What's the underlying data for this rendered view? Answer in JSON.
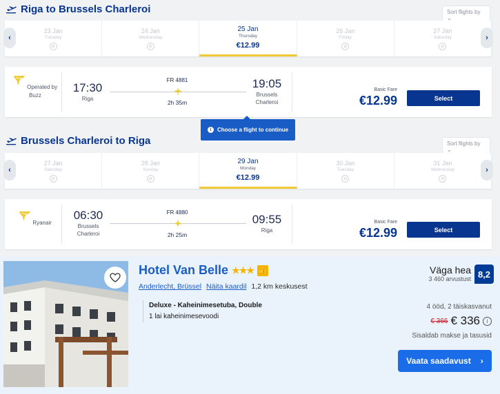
{
  "outbound": {
    "title": "Riga to Brussels Charleroi",
    "sort_label": "Sort flights by",
    "dates": [
      {
        "date": "23 Jan",
        "weekday": "Tuesday",
        "price": ""
      },
      {
        "date": "24 Jan",
        "weekday": "Wednesday",
        "price": ""
      },
      {
        "date": "25 Jan",
        "weekday": "Thursday",
        "price": "€12.99",
        "active": true
      },
      {
        "date": "26 Jan",
        "weekday": "Friday",
        "price": ""
      },
      {
        "date": "27 Jan",
        "weekday": "Saturday",
        "price": ""
      }
    ],
    "flight": {
      "operator": "Operated by Buzz",
      "depart_time": "17:30",
      "depart_city": "Riga",
      "flight_no": "FR 4881",
      "duration": "2h 35m",
      "arrive_time": "19:05",
      "arrive_city": "Brussels Charleroi",
      "fare_label": "Basic Fare",
      "price": "€12.99",
      "select_label": "Select"
    }
  },
  "tooltip": "Choose a flight to continue",
  "inbound": {
    "title": "Brussels Charleroi to Riga",
    "sort_label": "Sort flights by",
    "dates": [
      {
        "date": "27 Jan",
        "weekday": "Saturday",
        "price": ""
      },
      {
        "date": "28 Jan",
        "weekday": "Sunday",
        "price": ""
      },
      {
        "date": "29 Jan",
        "weekday": "Monday",
        "price": "€12.99",
        "active": true
      },
      {
        "date": "30 Jan",
        "weekday": "Tuesday",
        "price": ""
      },
      {
        "date": "31 Jan",
        "weekday": "Wednesday",
        "price": ""
      }
    ],
    "flight": {
      "operator": "Ryanair",
      "depart_time": "06:30",
      "depart_city": "Brussels Charleroi",
      "flight_no": "FR 4880",
      "duration": "2h 25m",
      "arrive_time": "09:55",
      "arrive_city": "Riga",
      "fare_label": "Basic Fare",
      "price": "€12.99",
      "select_label": "Select"
    }
  },
  "hotel": {
    "name": "Hotel Van Belle",
    "stars": "★★★",
    "location_link": "Anderlecht, Brüssel",
    "map_link": "Näita kaardil",
    "distance": "1,2 km keskusest",
    "room_type": "Deluxe - Kaheinimesetuba, Double",
    "bed": "1 lai kaheinimesevoodi",
    "score_word": "Väga hea",
    "review_count": "3 460 arvustust",
    "score": "8,2",
    "stay": "4 ööd, 2 täiskasvanut",
    "old_price": "€ 366",
    "new_price": "€ 336",
    "taxes": "Sisaldab makse ja tasusid",
    "cta": "Vaata saadavust"
  },
  "colors": {
    "brand": "#073590",
    "accent": "#f1c933",
    "hotel_blue": "#1a6ce8"
  }
}
